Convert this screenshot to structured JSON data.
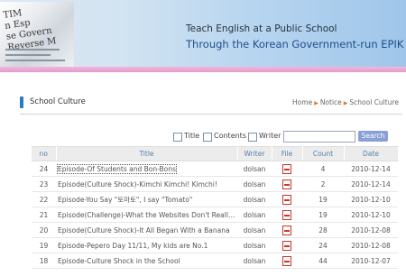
{
  "banner": {
    "line1": "Teach English at a Public School",
    "line2": "Through the Korean Government-run EPIK",
    "newspaper_text": "TIM\nn Esp\nse Govern\nReverse M"
  },
  "section": {
    "title": "School Culture",
    "breadcrumb": [
      "Home",
      "Notice",
      "School Culture"
    ]
  },
  "search": {
    "options": [
      "Title",
      "Contents",
      "Writer"
    ],
    "button": "Search",
    "value": ""
  },
  "table": {
    "headers": [
      "no",
      "Title",
      "Writer",
      "File",
      "Count",
      "Date"
    ],
    "rows": [
      {
        "no": "24",
        "title": "Episode-Of Students and Bon-Bons",
        "writer": "dolsan",
        "count": "4",
        "date": "2010-12-14"
      },
      {
        "no": "23",
        "title": "Episode(Culture Shock)-Kimchi Kimchi! Kimchi!",
        "writer": "dolsan",
        "count": "2",
        "date": "2010-12-14"
      },
      {
        "no": "22",
        "title": "Episode-You Say \"토마토\", I say \"Tomato\"",
        "writer": "dolsan",
        "count": "19",
        "date": "2010-12-10"
      },
      {
        "no": "21",
        "title": "Episode(Challenge)-What the Websites Don't Really ...",
        "writer": "dolsan",
        "count": "19",
        "date": "2010-12-10"
      },
      {
        "no": "20",
        "title": "Episode(Culture Shock)-It All Began With a Banana",
        "writer": "dolsan",
        "count": "28",
        "date": "2010-12-08"
      },
      {
        "no": "19",
        "title": "Episode-Pepero Day 11/11, My kids are No.1",
        "writer": "dolsan",
        "count": "24",
        "date": "2010-12-08"
      },
      {
        "no": "18",
        "title": "Episode-Culture Shock in the School",
        "writer": "dolsan",
        "count": "44",
        "date": "2010-12-07"
      }
    ]
  }
}
